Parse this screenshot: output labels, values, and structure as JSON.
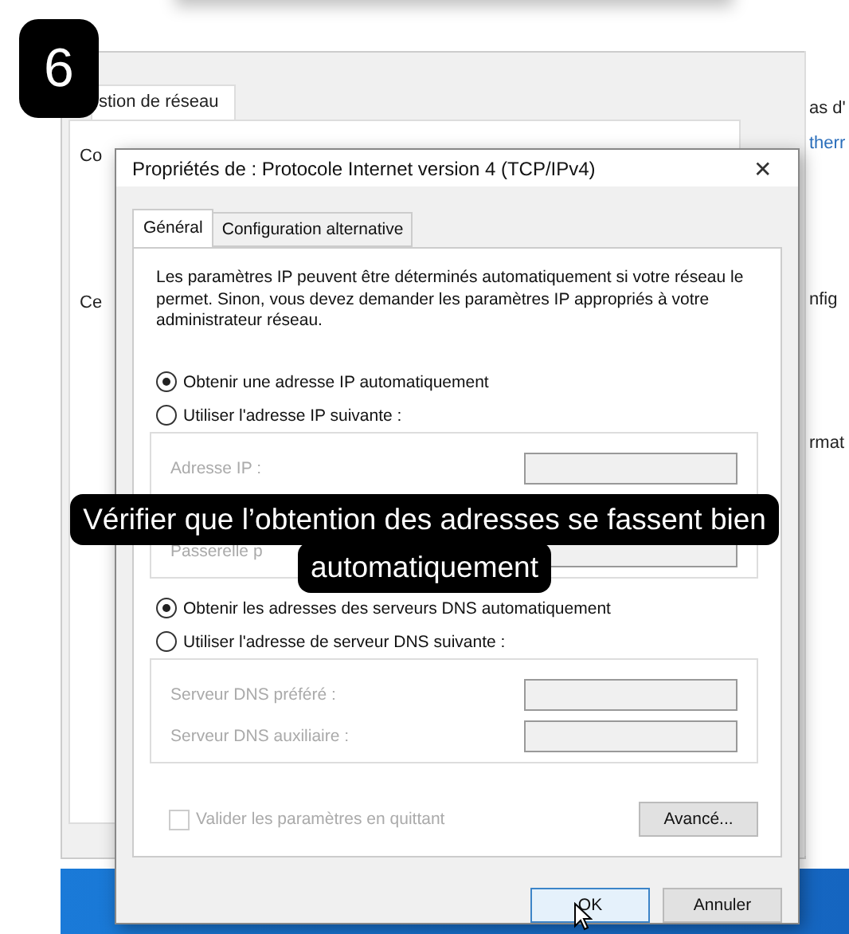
{
  "step_badge": "6",
  "background_window": {
    "tab": "stion de réseau",
    "left_labels": [
      "Co",
      "Ce"
    ],
    "right_labels": [
      "as d'",
      "therr",
      "nfig",
      "rmat"
    ]
  },
  "dialog": {
    "title": "Propriétés de : Protocole Internet version 4 (TCP/IPv4)",
    "close": "✕",
    "tabs": [
      {
        "label": "Général",
        "selected": true
      },
      {
        "label": "Configuration alternative",
        "selected": false
      }
    ],
    "description": "Les paramètres IP peuvent être déterminés automatiquement si votre réseau le permet. Sinon, vous devez demander les paramètres IP appropriés à votre administrateur réseau.",
    "ip_options": [
      {
        "label": "Obtenir une adresse IP automatiquement",
        "selected": true
      },
      {
        "label": "Utiliser l'adresse IP suivante :",
        "selected": false
      }
    ],
    "ip_fields": [
      {
        "label": "Adresse IP :"
      },
      {
        "label": "Passerelle p"
      }
    ],
    "dns_options": [
      {
        "label": "Obtenir les adresses des serveurs DNS automatiquement",
        "selected": true
      },
      {
        "label": "Utiliser l'adresse de serveur DNS suivante :",
        "selected": false
      }
    ],
    "dns_fields": [
      {
        "label": "Serveur DNS préféré :"
      },
      {
        "label": "Serveur DNS auxiliaire :"
      }
    ],
    "validate": {
      "label": "Valider les paramètres en quittant",
      "checked": false
    },
    "advanced_button": "Avancé...",
    "buttons": [
      {
        "label": "OK",
        "selected": true
      },
      {
        "label": "Annuler",
        "selected": false
      }
    ]
  },
  "caption_lines": [
    "Vérifier que l’obtention des adresses se fassent bien",
    "automatiquement"
  ]
}
